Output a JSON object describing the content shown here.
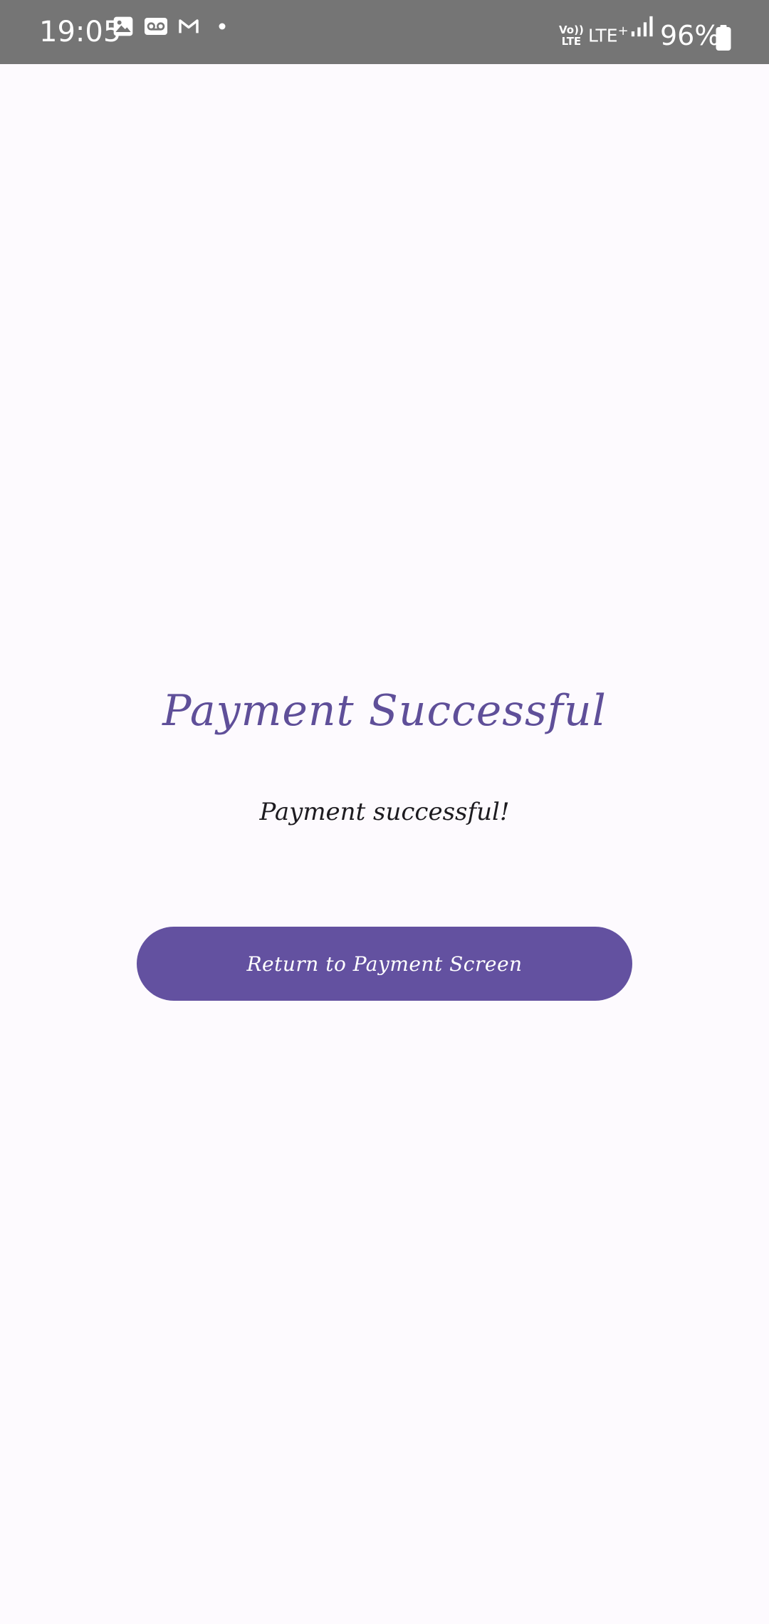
{
  "status_bar": {
    "time": "19:05",
    "volte_top": "Vo))",
    "volte_bottom": "LTE",
    "network": "LTE",
    "network_plus": "+",
    "battery": "96%",
    "icons": [
      "image-icon",
      "voicemail-icon",
      "gmail-icon",
      "dot-icon",
      "signal-icon",
      "battery-icon"
    ]
  },
  "main": {
    "title": "Payment Successful",
    "message": "Payment successful!",
    "return_button_label": "Return to Payment Screen"
  },
  "colors": {
    "status_bar_bg": "#757575",
    "page_bg": "#fdfafe",
    "accent": "#6351a0",
    "title_color": "#5f4f99",
    "text_color": "#1d1b20"
  }
}
